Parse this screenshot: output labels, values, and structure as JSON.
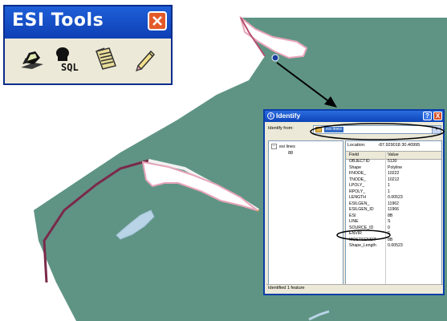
{
  "colors": {
    "water": "#5f9484",
    "land": "#ffffff",
    "shore_maroon": "#7a2a4a",
    "shore_pink": "#e8a4b8",
    "shore_orange": "#e2a040",
    "island": "#b8d4e6",
    "title_blue": "#0f3fb4"
  },
  "esi_tools": {
    "title": "ESI Tools",
    "close_icon": "close-x-icon",
    "tools": [
      {
        "name": "identify-map-tool",
        "icon": "map-pointer-icon"
      },
      {
        "name": "sql-query-tool",
        "icon": "sql-icon"
      },
      {
        "name": "legend-tool",
        "icon": "notepad-icon"
      },
      {
        "name": "edit-tool",
        "icon": "pencil-icon"
      }
    ]
  },
  "identify": {
    "title": "Identify",
    "help_button": "?",
    "close_button": "X",
    "identify_from_label": "Identify from:",
    "identify_from_value": "esi lines",
    "tree": {
      "layer": "esi lines",
      "feature": "88"
    },
    "location_label": "Location:",
    "location_value": "-87.929018  30.40995",
    "columns": [
      "Field",
      "Value"
    ],
    "rows": [
      {
        "field": "OBJECTID",
        "value": "5130"
      },
      {
        "field": "Shape",
        "value": "Polyline"
      },
      {
        "field": "FNODE_",
        "value": "10222"
      },
      {
        "field": "TNODE_",
        "value": "10212"
      },
      {
        "field": "LPOLY_",
        "value": "1"
      },
      {
        "field": "RPOLY_",
        "value": "1"
      },
      {
        "field": "LENGTH",
        "value": "0.00523"
      },
      {
        "field": "ESILGEN_",
        "value": "11962"
      },
      {
        "field": "ESILGEN_ID",
        "value": "11966"
      },
      {
        "field": "ESI",
        "value": "8B"
      },
      {
        "field": "LINE",
        "value": "S"
      },
      {
        "field": "SOURCE_ID",
        "value": "0"
      },
      {
        "field": "ENVIR",
        "value": "E"
      },
      {
        "field": "MOSTSENSIT",
        "value": "8B"
      },
      {
        "field": "Shape_Length",
        "value": "0.00523"
      }
    ],
    "status": "Identified 1 feature"
  }
}
